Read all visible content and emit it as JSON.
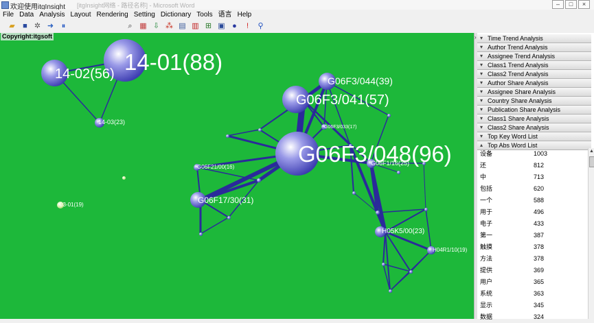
{
  "window": {
    "title": "欢迎使用itgInsight",
    "title_blurred": "[itgInsight网络 - 路径名称] - Microsoft Word"
  },
  "menu": [
    "File",
    "Data",
    "Analysis",
    "Layout",
    "Rendering",
    "Setting",
    "Dictionary",
    "Tools",
    "语言",
    "Help"
  ],
  "toolbar_icons": [
    "open-icon",
    "save-icon",
    "settings-icon",
    "next-icon",
    "pause-icon",
    "search-icon",
    "grid-icon",
    "import-icon",
    "cluster-icon",
    "table-icon",
    "chart-icon",
    "export-icon",
    "report-icon",
    "globe-icon",
    "marker-icon",
    "person-icon"
  ],
  "graph": {
    "copyright": "Copyright:itgsoft",
    "nodes": [
      {
        "label": "14-01(88)"
      },
      {
        "label": "14-02(56)"
      },
      {
        "label": "14-03(23)"
      },
      {
        "label": "03-01(19)"
      },
      {
        "label": "G06F3/044(39)"
      },
      {
        "label": "G06F3/041(57)"
      },
      {
        "label": "G06F3/048(96)"
      },
      {
        "label": "G06F3/033(17)"
      },
      {
        "label": "G06F1/16(25)"
      },
      {
        "label": "G06F21/00(16)"
      },
      {
        "label": "G06F17/30(31)"
      },
      {
        "label": "H05K5/00(23)"
      },
      {
        "label": "H04R1/10(19)"
      }
    ]
  },
  "panel": {
    "sections": [
      "Time Trend Analysis",
      "Author Trend Analysis",
      "Assignee Trend Analysis",
      "Class1 Trend Analysis",
      "Class2 Trend Analysis",
      "Author Share Analysis",
      "Assignee Share Analysis",
      "Country Share Analysis",
      "Publication Share Analysis",
      "Class1 Share Analysis",
      "Class2 Share Analysis",
      "Top Key Word List",
      "Top Abs Word List"
    ],
    "words": [
      {
        "word": "设备",
        "count": "1003"
      },
      {
        "word": "还",
        "count": "812"
      },
      {
        "word": "中",
        "count": "713"
      },
      {
        "word": "包括",
        "count": "620"
      },
      {
        "word": "一个",
        "count": "588"
      },
      {
        "word": "用于",
        "count": "496"
      },
      {
        "word": "电子",
        "count": "433"
      },
      {
        "word": "第一",
        "count": "387"
      },
      {
        "word": "触摸",
        "count": "378"
      },
      {
        "word": "方法",
        "count": "378"
      },
      {
        "word": "提供",
        "count": "369"
      },
      {
        "word": "用户",
        "count": "365"
      },
      {
        "word": "系统",
        "count": "363"
      },
      {
        "word": "显示",
        "count": "345"
      },
      {
        "word": "数据",
        "count": "324"
      }
    ]
  }
}
